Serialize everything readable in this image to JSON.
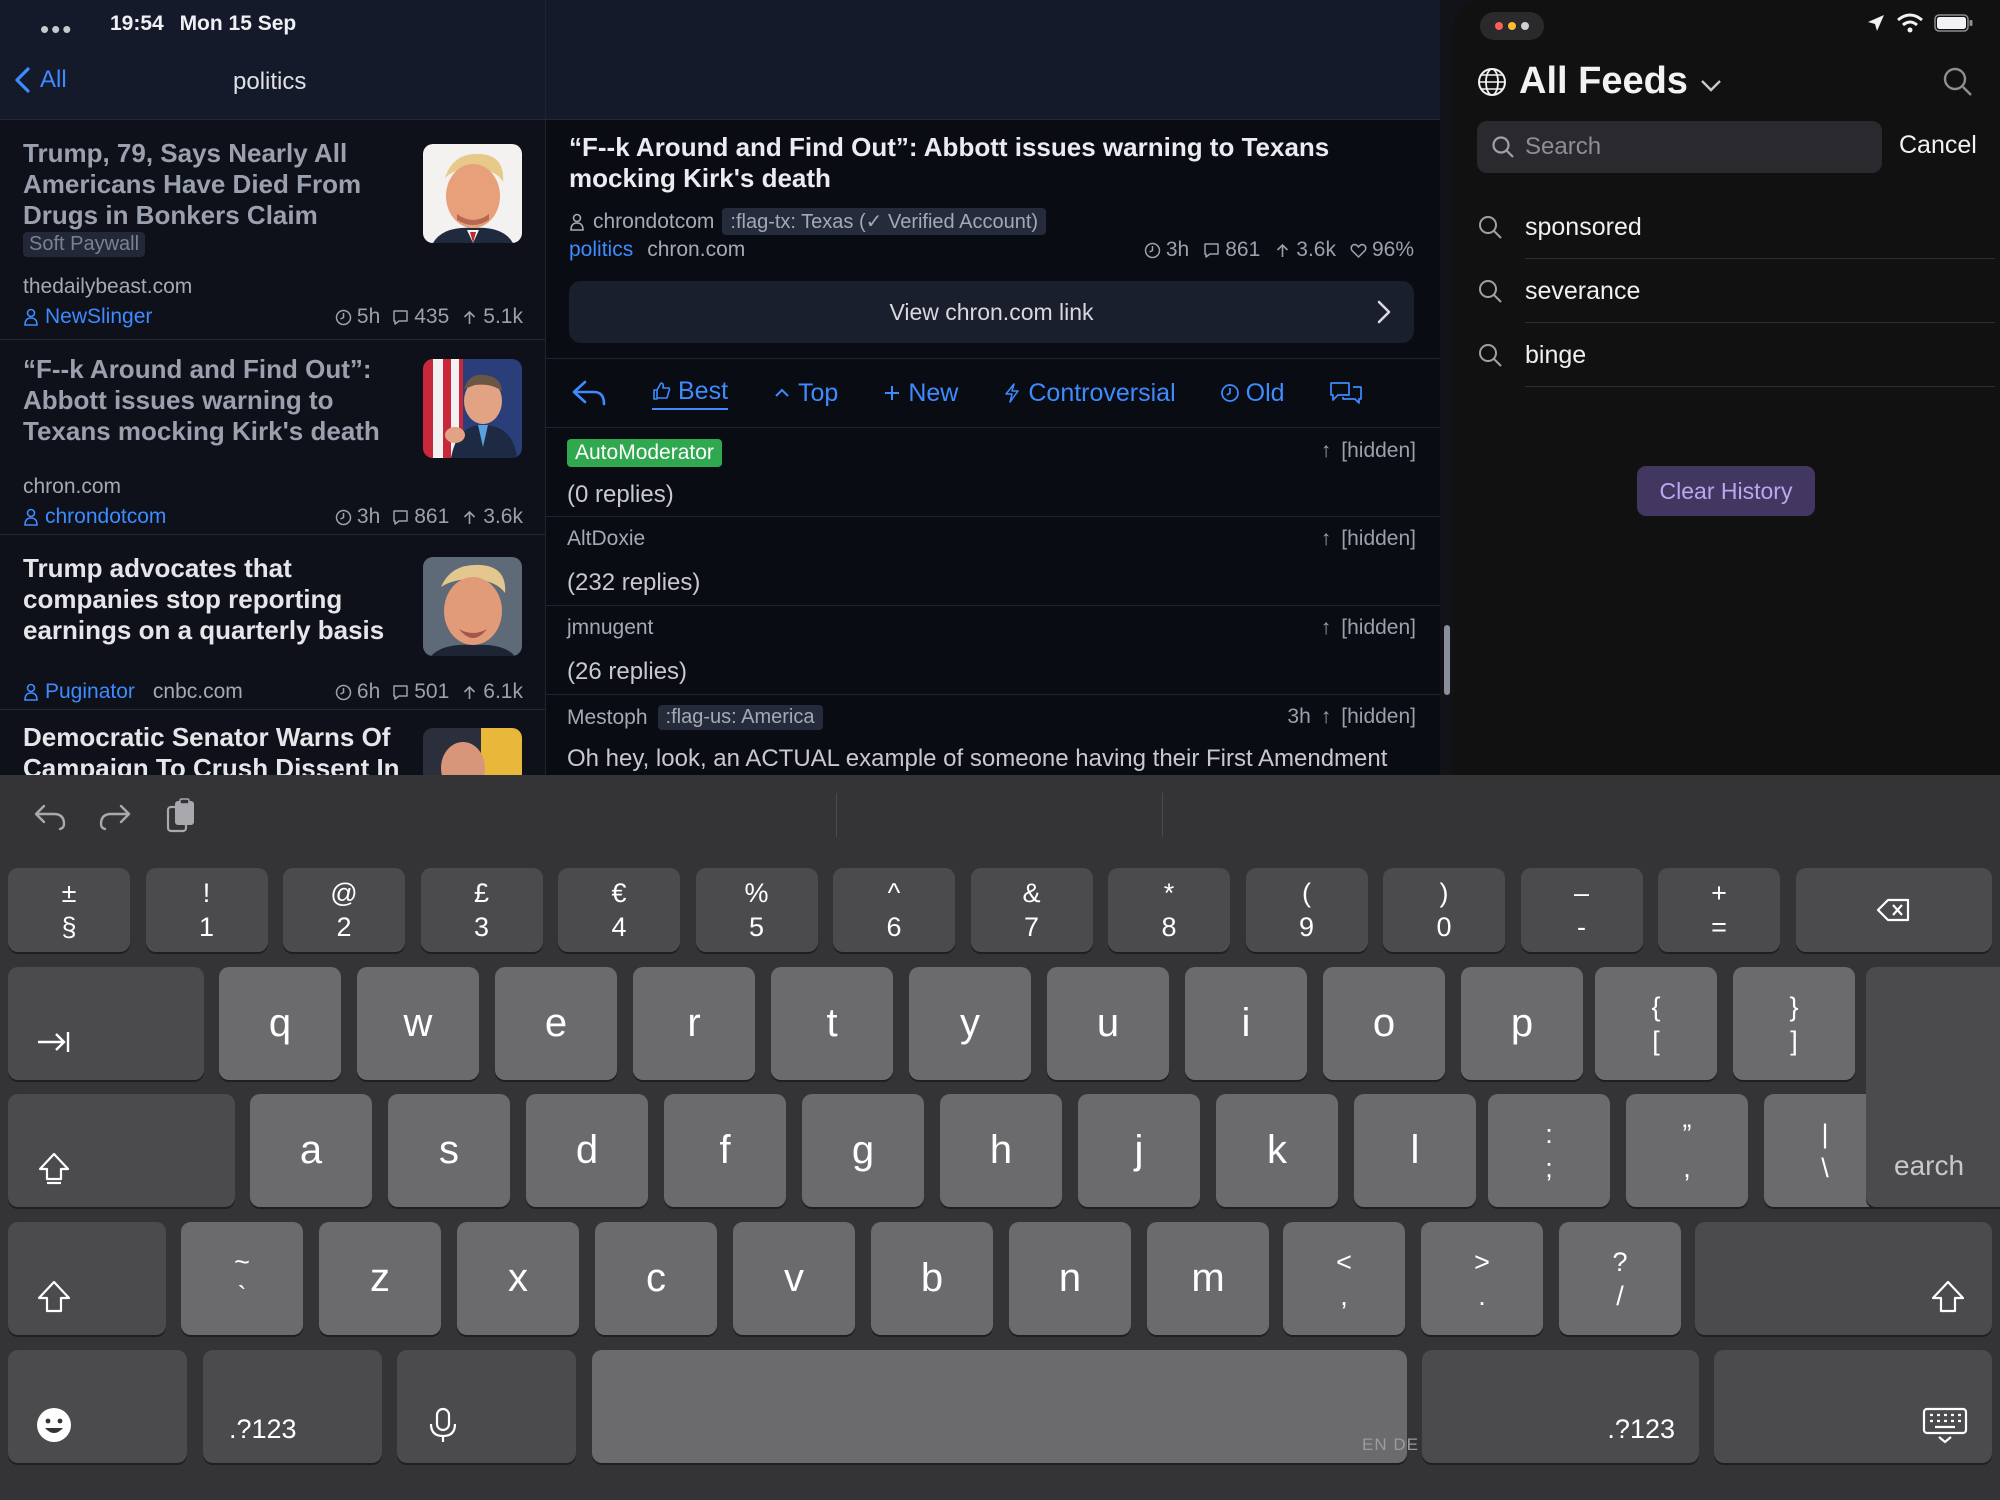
{
  "status": {
    "dots": "•••",
    "time": "19:54",
    "date": "Mon 15 Sep"
  },
  "left": {
    "back_label": "All",
    "title": "politics",
    "posts": [
      {
        "title": "Trump, 79, Says Nearly All Americans Have Died From Drugs in Bonkers Claim",
        "tag": "Soft Paywall",
        "domain": "thedailybeast.com",
        "user": "NewSlinger",
        "time": "5h",
        "comments": "435",
        "score": "5.1k"
      },
      {
        "title": "“F--k Around and Find Out”: Abbott issues warning to Texans mocking Kirk's death",
        "domain": "chron.com",
        "user": "chrondotcom",
        "time": "3h",
        "comments": "861",
        "score": "3.6k"
      },
      {
        "title": "Trump advocates that companies stop reporting earnings on a quarterly basis",
        "user": "Puginator",
        "domain": "cnbc.com",
        "time": "6h",
        "comments": "501",
        "score": "6.1k"
      },
      {
        "title": "Democratic Senator Warns Of Campaign To Crush Dissent In"
      }
    ]
  },
  "mid": {
    "title": "“F--k Around and Find Out”: Abbott issues warning to Texans mocking Kirk's death",
    "author": "chrondotcom",
    "flair": ":flag-tx: Texas (✓ Verified Account)",
    "subreddit": "politics",
    "domain": "chron.com",
    "time": "3h",
    "comments": "861",
    "score": "3.6k",
    "ratio": "96%",
    "view_link": "View chron.com link",
    "sorts": [
      "Best",
      "Top",
      "New",
      "Controversial",
      "Old"
    ],
    "comments_list": [
      {
        "author": "AutoModerator",
        "score": "[hidden]",
        "body": "(0 replies)"
      },
      {
        "author": "AltDoxie",
        "score": "[hidden]",
        "body": "(232 replies)"
      },
      {
        "author": "jmnugent",
        "score": "[hidden]",
        "body": "(26 replies)"
      },
      {
        "author": "Mestoph",
        "flair": ":flag-us: America",
        "time": "3h",
        "score": "[hidden]",
        "body": "Oh hey, look, an ACTUAL example of someone having their First Amendment"
      }
    ]
  },
  "right": {
    "title": "All Feeds",
    "search_placeholder": "Search",
    "cancel": "Cancel",
    "history": [
      "sponsored",
      "severance",
      "binge"
    ],
    "clear_history": "Clear History"
  },
  "keyboard": {
    "row1": [
      {
        "top": "±",
        "bottom": "§"
      },
      {
        "top": "!",
        "bottom": "1"
      },
      {
        "top": "@",
        "bottom": "2"
      },
      {
        "top": "£",
        "bottom": "3"
      },
      {
        "top": "€",
        "bottom": "4"
      },
      {
        "top": "%",
        "bottom": "5"
      },
      {
        "top": "^",
        "bottom": "6"
      },
      {
        "top": "&",
        "bottom": "7"
      },
      {
        "top": "*",
        "bottom": "8"
      },
      {
        "top": "(",
        "bottom": "9"
      },
      {
        "top": ")",
        "bottom": "0"
      },
      {
        "top": "–",
        "bottom": "-"
      },
      {
        "top": "+",
        "bottom": "="
      }
    ],
    "row2": [
      "q",
      "w",
      "e",
      "r",
      "t",
      "y",
      "u",
      "i",
      "o",
      "p"
    ],
    "row2_sym": [
      {
        "top": "{",
        "bottom": "["
      },
      {
        "top": "}",
        "bottom": "]"
      }
    ],
    "row3": [
      "a",
      "s",
      "d",
      "f",
      "g",
      "h",
      "j",
      "k",
      "l"
    ],
    "row3_sym": [
      {
        "top": ":",
        "bottom": ";"
      },
      {
        "top": "”",
        "bottom": ","
      },
      {
        "top": "|",
        "bottom": "\\"
      }
    ],
    "row4_sym_left": {
      "top": "~",
      "bottom": "`"
    },
    "row4": [
      "z",
      "x",
      "c",
      "v",
      "b",
      "n",
      "m"
    ],
    "row4_sym": [
      {
        "top": "<",
        "bottom": ","
      },
      {
        "top": ">",
        "bottom": "."
      },
      {
        "top": "?",
        "bottom": "/"
      }
    ],
    "numbers_label": ".?123",
    "numbers_label_right": ".?123",
    "search_key": "earch",
    "lang": "EN DE"
  }
}
